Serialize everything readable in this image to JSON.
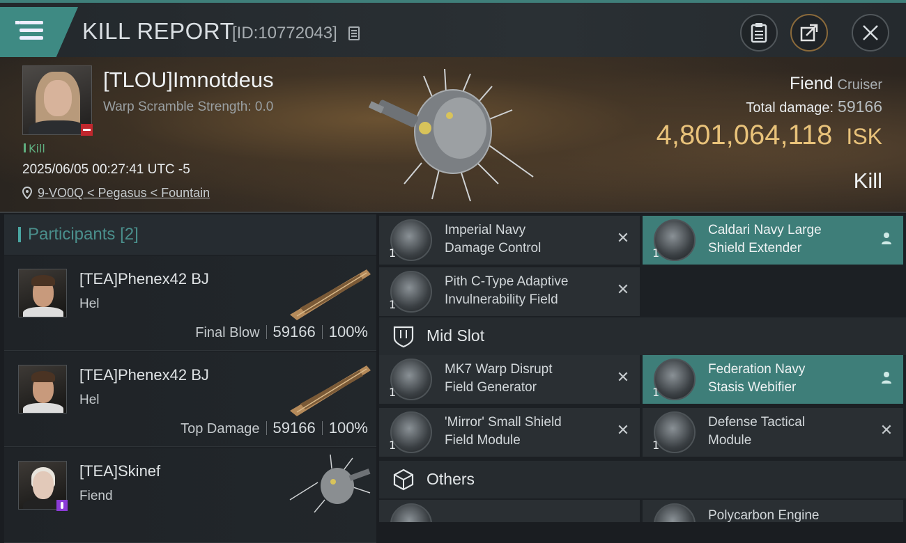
{
  "header": {
    "title": "KILL REPORT",
    "kill_id": "[ID:10772043]",
    "icons": [
      "menu-icon",
      "copy-icon",
      "clipboard-icon",
      "share-icon",
      "close-icon"
    ]
  },
  "victim": {
    "name": "[TLOU]Imnotdeus",
    "warp_scramble": "Warp Scramble Strength: 0.0",
    "kill_tag": "Kill",
    "timestamp": "2025/06/05 00:27:41 UTC -5",
    "location": "9-VO0Q < Pegasus < Fountain",
    "ship_name": "Fiend",
    "ship_class": "Cruiser",
    "total_damage_label": "Total damage:",
    "total_damage": "59166",
    "isk_value": "4,801,064,118",
    "isk_unit": "ISK",
    "result": "Kill"
  },
  "participants": {
    "header": "Participants",
    "count": "[2]",
    "rows": [
      {
        "name": "[TEA]Phenex42 BJ",
        "ship": "Hel",
        "role": "Final Blow",
        "damage": "59166",
        "percent": "100%"
      },
      {
        "name": "[TEA]Phenex42 BJ",
        "ship": "Hel",
        "role": "Top Damage",
        "damage": "59166",
        "percent": "100%"
      },
      {
        "name": "[TEA]Skinef",
        "ship": "Fiend"
      }
    ]
  },
  "modules": {
    "low_slot": [
      {
        "name_line1": "Imperial Navy",
        "name_line2": "Damage Control",
        "qty": "1",
        "status": "destroyed"
      },
      {
        "name_line1": "Caldari Navy Large",
        "name_line2": "Shield Extender",
        "qty": "1",
        "status": "dropped"
      },
      {
        "name_line1": "Pith C-Type Adaptive",
        "name_line2": "Invulnerability Field",
        "qty": "1",
        "status": "destroyed"
      }
    ],
    "mid_slot_label": "Mid Slot",
    "mid_slot": [
      {
        "name_line1": "MK7 Warp Disrupt",
        "name_line2": "Field Generator",
        "qty": "1",
        "status": "destroyed"
      },
      {
        "name_line1": "Federation Navy",
        "name_line2": "Stasis Webifier",
        "qty": "1",
        "status": "dropped"
      },
      {
        "name_line1": "'Mirror' Small Shield",
        "name_line2": "Field Module",
        "qty": "1",
        "status": "destroyed"
      },
      {
        "name_line1": "Defense Tactical",
        "name_line2": "Module",
        "qty": "1",
        "status": "destroyed"
      }
    ],
    "others_label": "Others",
    "others": [
      {
        "name_line1": "Polycarbon Engine"
      }
    ]
  },
  "colors": {
    "accent": "#3e8a83",
    "isk": "#e8c27a",
    "dropped_bg": "#3e7e79"
  }
}
